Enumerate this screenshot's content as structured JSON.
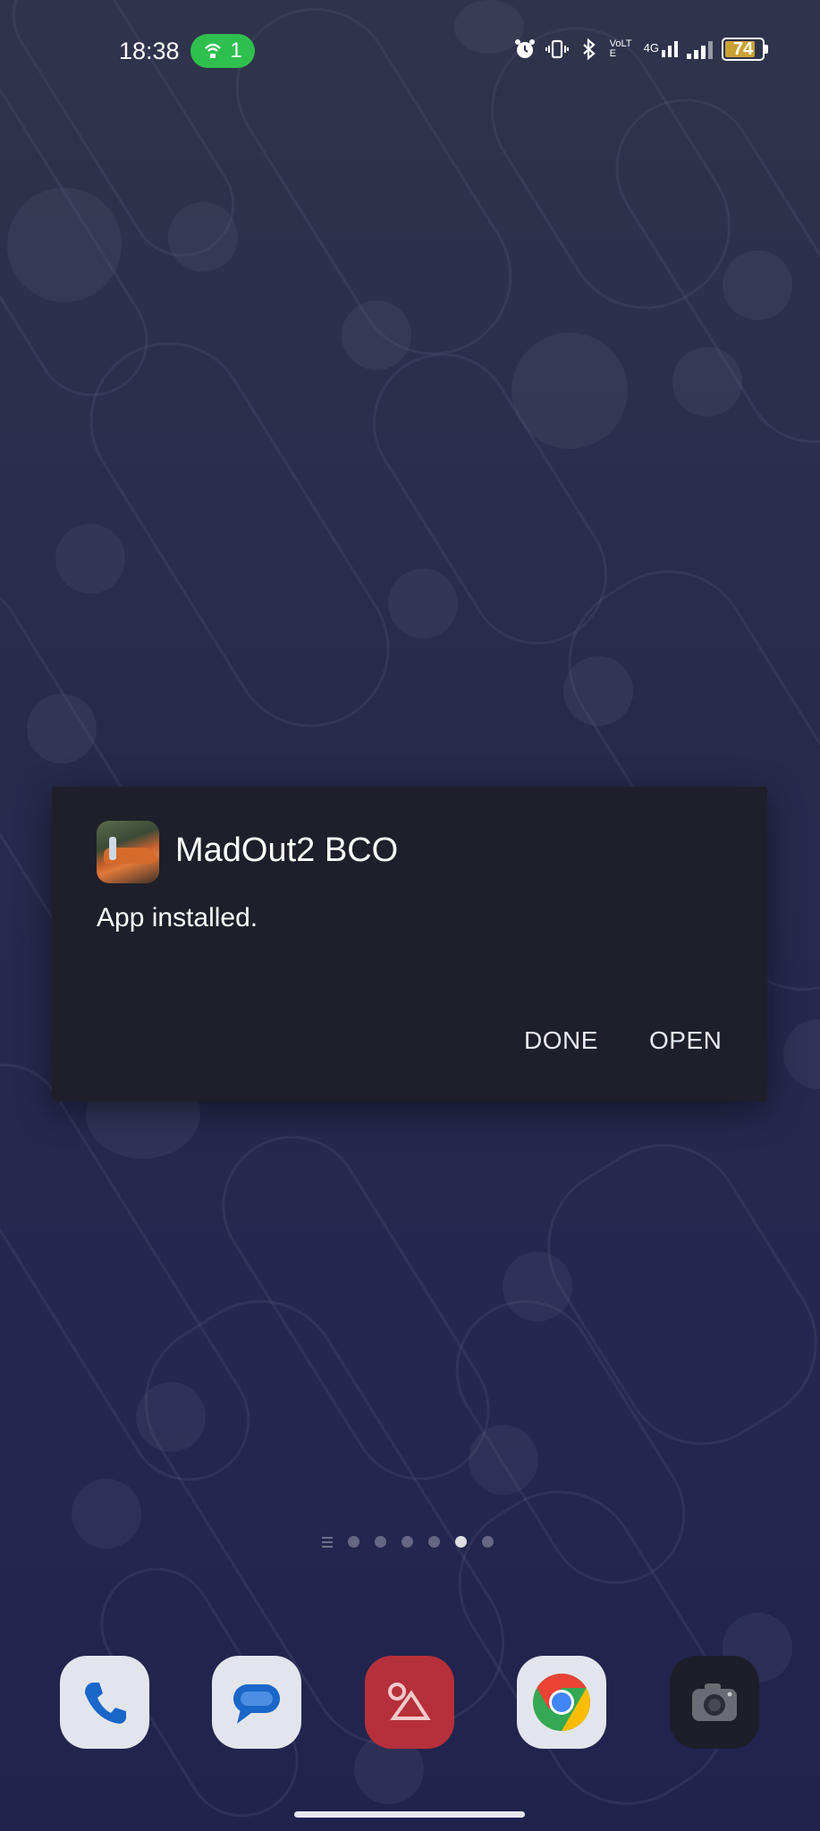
{
  "status_bar": {
    "time": "18:38",
    "hotspot_count": "1",
    "battery_level": "74",
    "network": "4G",
    "volte": "VoLTE",
    "icons": [
      "alarm-icon",
      "vibrate-icon",
      "bluetooth-icon",
      "volte-icon",
      "signal-4g-icon",
      "signal-icon",
      "battery-icon"
    ]
  },
  "dialog": {
    "app_name": "MadOut2 BCO",
    "message": "App installed.",
    "done_label": "DONE",
    "open_label": "OPEN"
  },
  "pager": {
    "pages": 6,
    "active_index": 4
  },
  "dock": {
    "apps": [
      {
        "name": "Phone",
        "icon": "phone-icon",
        "color": "#e8eaf0"
      },
      {
        "name": "Messages",
        "icon": "messages-icon",
        "color": "#e8eaf0"
      },
      {
        "name": "Gallery",
        "icon": "gallery-icon",
        "color": "#c0313b"
      },
      {
        "name": "Chrome",
        "icon": "chrome-icon",
        "color": "#e8eaf0"
      },
      {
        "name": "Camera",
        "icon": "camera-icon",
        "color": "#1c1e2a"
      }
    ]
  },
  "colors": {
    "hotspot": "#2fbf4f",
    "dialog_bg": "#1e1f2a",
    "battery_fill": "#c9a233"
  }
}
